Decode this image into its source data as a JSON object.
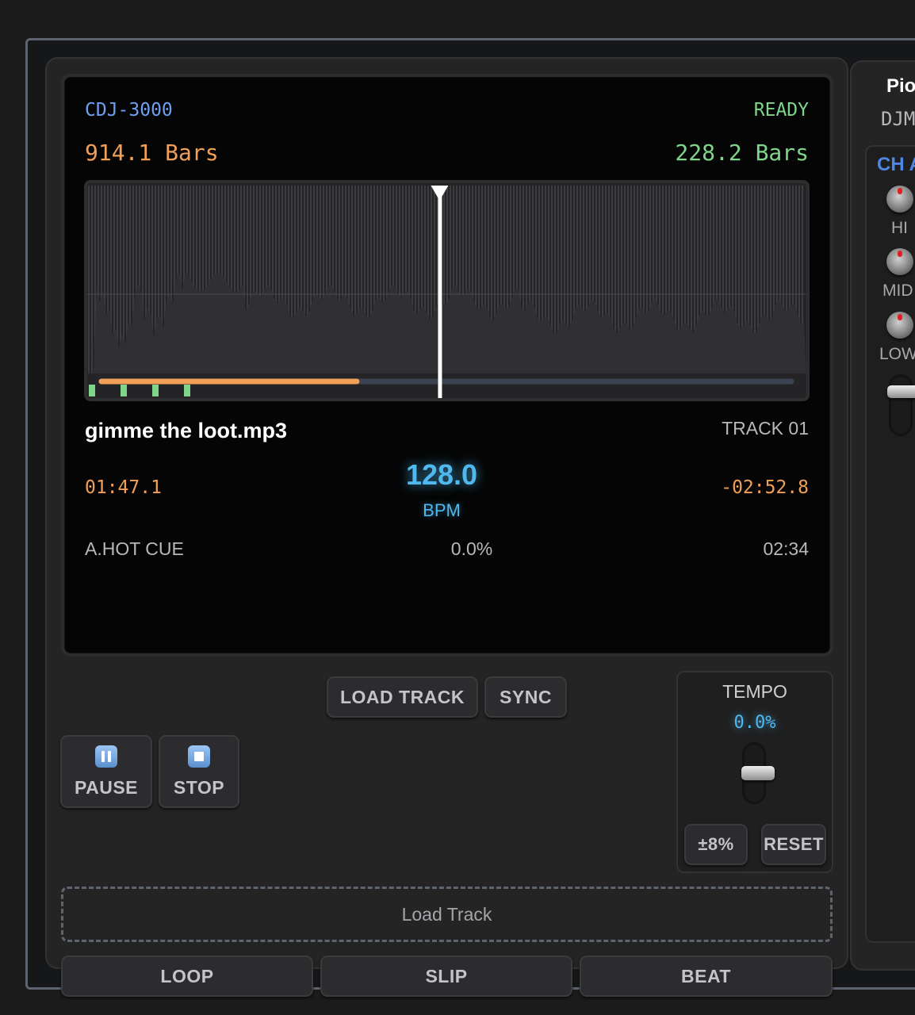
{
  "deck": {
    "model": "CDJ-3000",
    "status": "READY",
    "bars_elapsed": "914.1 Bars",
    "bars_remaining": "228.2 Bars",
    "track_title": "gimme the loot.mp3",
    "track_number": "TRACK 01",
    "time_elapsed": "01:47.1",
    "time_remaining": "-02:52.8",
    "bpm_value": "128.0",
    "bpm_label": "BPM",
    "cue_mode": "A.HOT CUE",
    "pitch_display": "0.0%",
    "total_time": "02:34",
    "playback_progress": 0.37,
    "playhead_position": 0.49
  },
  "buttons": {
    "load_track": "LOAD TRACK",
    "sync": "SYNC",
    "pause": "PAUSE",
    "stop": "STOP",
    "range": "±8%",
    "reset": "RESET",
    "loop": "LOOP",
    "slip": "SLIP",
    "beat": "BEAT"
  },
  "tempo": {
    "label": "TEMPO",
    "value": "0.0%",
    "fader_level": 0.5
  },
  "dropzone": {
    "label": "Load Track"
  },
  "mixer": {
    "brand": "Pio",
    "model": "DJM",
    "channel": "CH A",
    "eq_labels": [
      "HI",
      "MID",
      "LOW"
    ]
  },
  "colors": {
    "model_text": "#6ea0f0",
    "status_text": "#7fd68a",
    "progress_played": "#f0a058",
    "bpm_glow": "#4fb8ef",
    "cue_marker": "#7fd68a"
  },
  "icons": [
    "pause-icon",
    "stop-icon",
    "playhead-marker-icon"
  ]
}
